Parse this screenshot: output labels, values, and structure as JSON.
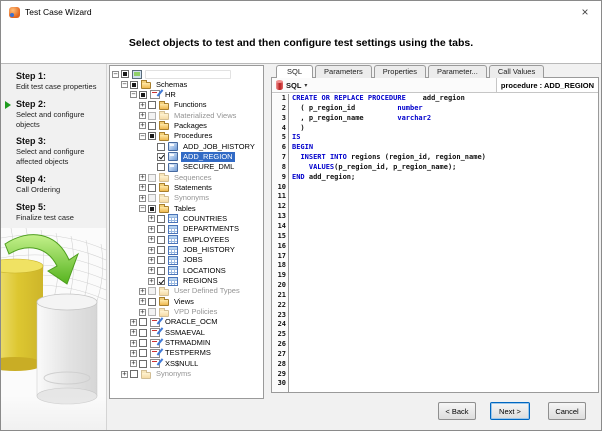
{
  "window": {
    "title": "Test Case Wizard",
    "close_label": "×"
  },
  "header": {
    "instruction": "Select objects to test and then configure test settings using the tabs."
  },
  "steps": {
    "items": [
      {
        "title": "Step 1:",
        "desc": "Edit test case properties",
        "active": false
      },
      {
        "title": "Step 2:",
        "desc": "Select and configure objects",
        "active": true
      },
      {
        "title": "Step 3:",
        "desc": "Select and configure affected objects",
        "active": false
      },
      {
        "title": "Step 4:",
        "desc": "Call Ordering",
        "active": false
      },
      {
        "title": "Step 5:",
        "desc": "Finalize test case",
        "active": false
      }
    ]
  },
  "tree": {
    "items": [
      {
        "label": "",
        "level": 0,
        "expander": "minus",
        "check": "partial",
        "icon": "connection",
        "dim": false,
        "selected": false
      },
      {
        "label": "Schemas",
        "level": 1,
        "expander": "minus",
        "check": "partial",
        "icon": "folder",
        "dim": false,
        "selected": false
      },
      {
        "label": "HR",
        "level": 2,
        "expander": "minus",
        "check": "partial",
        "icon": "schema",
        "dim": false,
        "selected": false
      },
      {
        "label": "Functions",
        "level": 3,
        "expander": "plus",
        "check": "unchecked",
        "icon": "folder",
        "dim": false,
        "selected": false
      },
      {
        "label": "Materialized Views",
        "level": 3,
        "expander": "plus",
        "check": "grayed",
        "icon": "folder",
        "dim": true,
        "selected": false
      },
      {
        "label": "Packages",
        "level": 3,
        "expander": "plus",
        "check": "unchecked",
        "icon": "folder",
        "dim": false,
        "selected": false
      },
      {
        "label": "Procedures",
        "level": 3,
        "expander": "minus",
        "check": "partial",
        "icon": "folder",
        "dim": false,
        "selected": false
      },
      {
        "label": "ADD_JOB_HISTORY",
        "level": 4,
        "expander": "none",
        "check": "unchecked",
        "icon": "proc",
        "dim": false,
        "selected": false
      },
      {
        "label": "ADD_REGION",
        "level": 4,
        "expander": "none",
        "check": "checked",
        "icon": "proc",
        "dim": false,
        "selected": true
      },
      {
        "label": "SECURE_DML",
        "level": 4,
        "expander": "none",
        "check": "unchecked",
        "icon": "proc",
        "dim": false,
        "selected": false
      },
      {
        "label": "Sequences",
        "level": 3,
        "expander": "plus",
        "check": "grayed",
        "icon": "folder",
        "dim": true,
        "selected": false
      },
      {
        "label": "Statements",
        "level": 3,
        "expander": "plus",
        "check": "unchecked",
        "icon": "folder",
        "dim": false,
        "selected": false
      },
      {
        "label": "Synonyms",
        "level": 3,
        "expander": "plus",
        "check": "grayed",
        "icon": "folder",
        "dim": true,
        "selected": false
      },
      {
        "label": "Tables",
        "level": 3,
        "expander": "minus",
        "check": "partial",
        "icon": "folder",
        "dim": false,
        "selected": false
      },
      {
        "label": "COUNTRIES",
        "level": 4,
        "expander": "plus",
        "check": "unchecked",
        "icon": "table",
        "dim": false,
        "selected": false
      },
      {
        "label": "DEPARTMENTS",
        "level": 4,
        "expander": "plus",
        "check": "unchecked",
        "icon": "table",
        "dim": false,
        "selected": false
      },
      {
        "label": "EMPLOYEES",
        "level": 4,
        "expander": "plus",
        "check": "unchecked",
        "icon": "table",
        "dim": false,
        "selected": false
      },
      {
        "label": "JOB_HISTORY",
        "level": 4,
        "expander": "plus",
        "check": "unchecked",
        "icon": "table",
        "dim": false,
        "selected": false
      },
      {
        "label": "JOBS",
        "level": 4,
        "expander": "plus",
        "check": "unchecked",
        "icon": "table",
        "dim": false,
        "selected": false
      },
      {
        "label": "LOCATIONS",
        "level": 4,
        "expander": "plus",
        "check": "unchecked",
        "icon": "table",
        "dim": false,
        "selected": false
      },
      {
        "label": "REGIONS",
        "level": 4,
        "expander": "plus",
        "check": "checked",
        "icon": "table",
        "dim": false,
        "selected": false
      },
      {
        "label": "User Defined Types",
        "level": 3,
        "expander": "plus",
        "check": "grayed",
        "icon": "folder",
        "dim": true,
        "selected": false
      },
      {
        "label": "Views",
        "level": 3,
        "expander": "plus",
        "check": "unchecked",
        "icon": "folder",
        "dim": false,
        "selected": false
      },
      {
        "label": "VPD Policies",
        "level": 3,
        "expander": "plus",
        "check": "grayed",
        "icon": "folder",
        "dim": true,
        "selected": false
      },
      {
        "label": "ORACLE_OCM",
        "level": 2,
        "expander": "plus",
        "check": "unchecked",
        "icon": "schema",
        "dim": false,
        "selected": false
      },
      {
        "label": "SSMAEVAL",
        "level": 2,
        "expander": "plus",
        "check": "unchecked",
        "icon": "schema",
        "dim": false,
        "selected": false
      },
      {
        "label": "STRMADMIN",
        "level": 2,
        "expander": "plus",
        "check": "unchecked",
        "icon": "schema",
        "dim": false,
        "selected": false
      },
      {
        "label": "TESTPERMS",
        "level": 2,
        "expander": "plus",
        "check": "unchecked",
        "icon": "schema",
        "dim": false,
        "selected": false
      },
      {
        "label": "XS$NULL",
        "level": 2,
        "expander": "plus",
        "check": "unchecked",
        "icon": "schema",
        "dim": false,
        "selected": false
      },
      {
        "label": "Synonyms",
        "level": 1,
        "expander": "plus",
        "check": "unchecked",
        "icon": "folder",
        "dim": true,
        "selected": false
      }
    ]
  },
  "editor_tabs": [
    {
      "label": "SQL",
      "active": true
    },
    {
      "label": "Parameters",
      "active": false
    },
    {
      "label": "Properties",
      "active": false
    },
    {
      "label": "Parameter...",
      "active": false
    },
    {
      "label": "Call Values",
      "active": false
    }
  ],
  "toolbar": {
    "dropdown_label": "SQL",
    "caret": "▾",
    "object_label": "procedure : ADD_REGION"
  },
  "code": {
    "total_lines": 30,
    "lines": [
      [
        {
          "t": "CREATE OR REPLACE PROCEDURE",
          "k": true
        },
        {
          "t": "    add_region"
        }
      ],
      [
        {
          "t": "  ( p_region_id          "
        },
        {
          "t": "number",
          "k": true
        }
      ],
      [
        {
          "t": "  , p_region_name        "
        },
        {
          "t": "varchar2",
          "k": true
        }
      ],
      [
        {
          "t": "  )"
        }
      ],
      [
        {
          "t": "IS",
          "k": true
        }
      ],
      [
        {
          "t": "BEGIN",
          "k": true
        }
      ],
      [
        {
          "t": "  "
        },
        {
          "t": "INSERT INTO",
          "k": true
        },
        {
          "t": " regions (region_id, region_name)"
        }
      ],
      [
        {
          "t": "    "
        },
        {
          "t": "VALUES",
          "k": true
        },
        {
          "t": "(p_region_id, p_region_name);"
        }
      ],
      [
        {
          "t": "END",
          "k": true
        },
        {
          "t": " add_region;"
        }
      ]
    ]
  },
  "footer": {
    "back_label": "< Back",
    "next_label": "Next >",
    "cancel_label": "Cancel"
  },
  "colors": {
    "selection": "#316ac5",
    "keyword": "#0000cc",
    "step_arrow_green": "#1e9b1e",
    "folder_yellow": "#efb94f",
    "db_icon_red": "#b81f1f",
    "graphic_yellow": "#e3cc3f",
    "graphic_green": "#6fc832"
  }
}
